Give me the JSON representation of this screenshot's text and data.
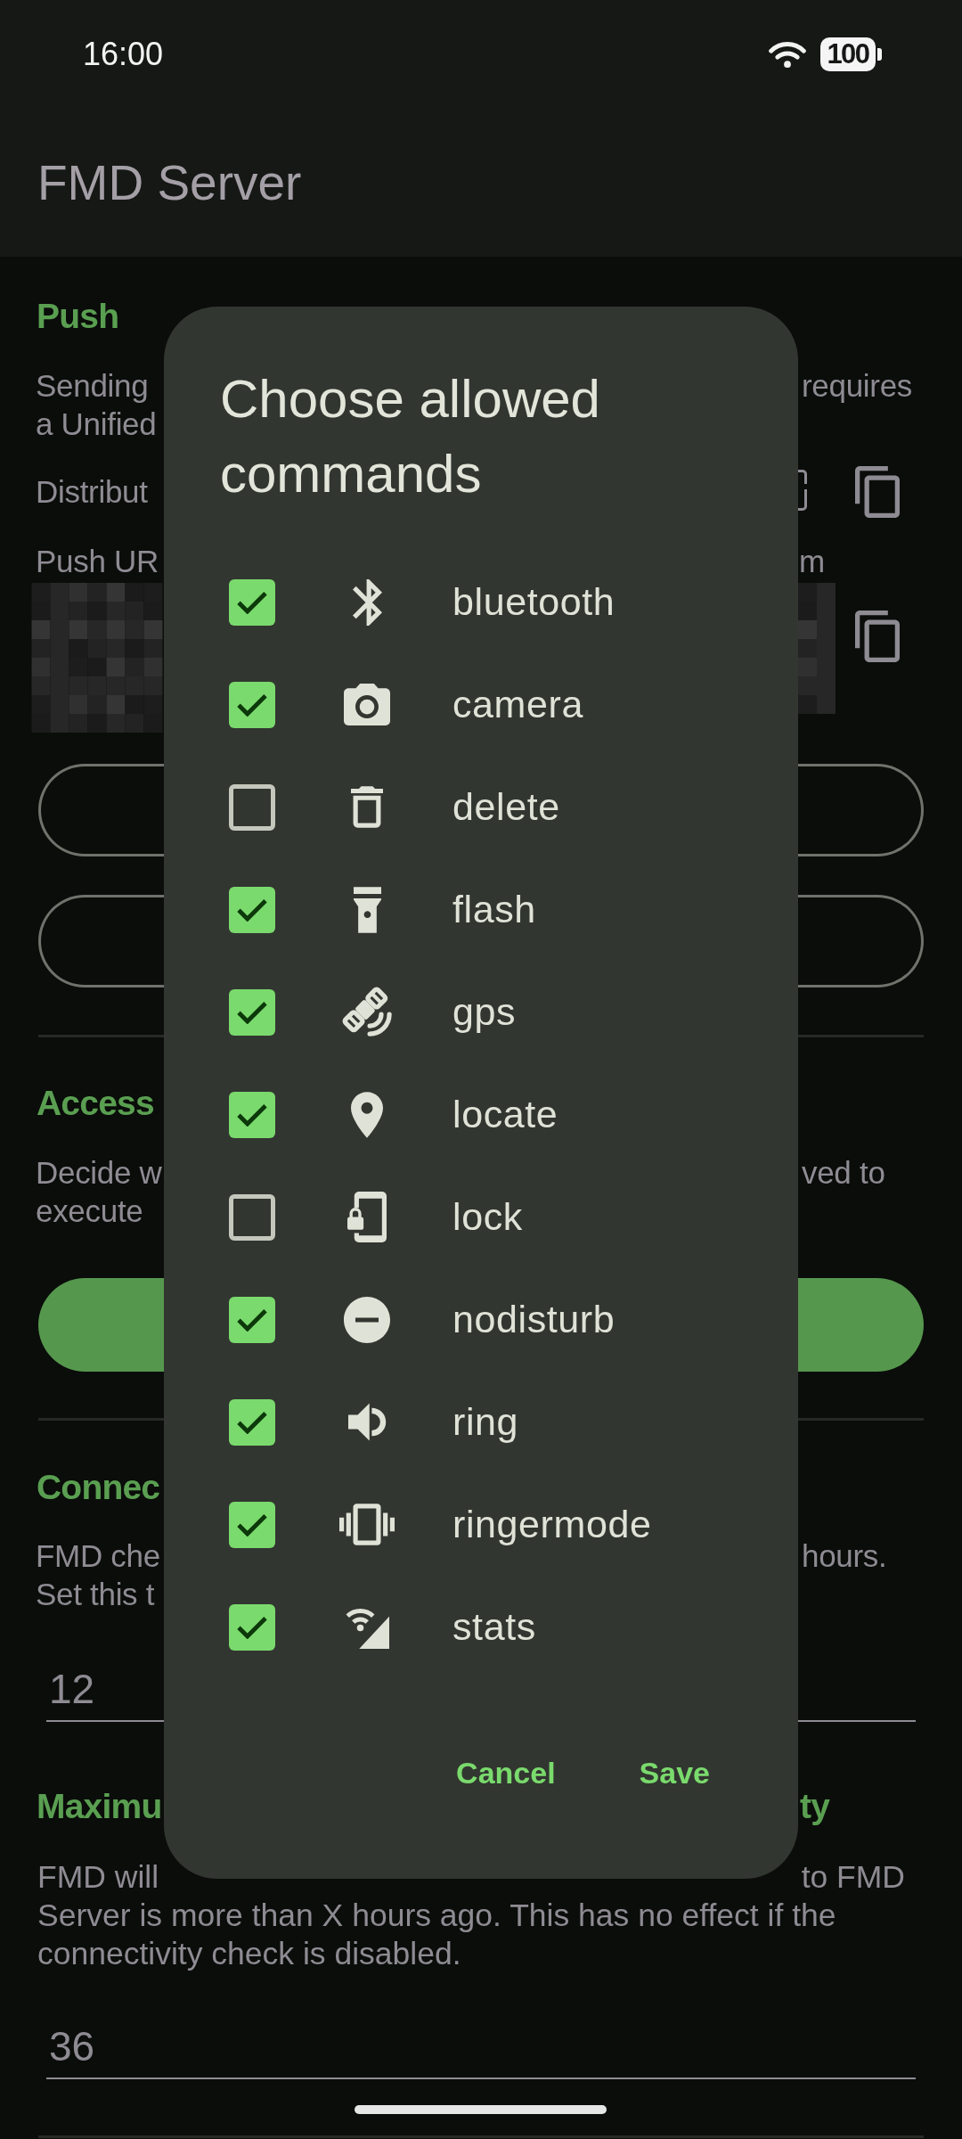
{
  "status_bar": {
    "time": "16:00",
    "battery": "100"
  },
  "app_bar": {
    "title": "FMD Server"
  },
  "push": {
    "heading": "Push",
    "description_lines": [
      {
        "left": "Sending",
        "right": "requires"
      },
      {
        "left": "a Unified"
      }
    ],
    "distributor_label": "Distribut",
    "push_url_label": "Push UR",
    "push_url_right": "m"
  },
  "access": {
    "heading": "Access",
    "description_lines": [
      {
        "left": "Decide w",
        "right": "ved to"
      },
      {
        "left": "execute"
      }
    ]
  },
  "connectivity": {
    "heading": "Connec",
    "description_lines": [
      {
        "left": "FMD che",
        "right": "hours."
      },
      {
        "left": "Set this t"
      }
    ],
    "value": "12"
  },
  "max_hours": {
    "heading_left": "Maximu",
    "heading_right": "ty",
    "description_first_line": {
      "left": "FMD will",
      "right": "to FMD"
    },
    "description_rest": "Server is more than X hours ago. This has no effect if the connectivity check is disabled.",
    "value": "36"
  },
  "dialog": {
    "title": "Choose allowed commands",
    "commands": [
      {
        "label": "bluetooth",
        "checked": true
      },
      {
        "label": "camera",
        "checked": true
      },
      {
        "label": "delete",
        "checked": false
      },
      {
        "label": "flash",
        "checked": true
      },
      {
        "label": "gps",
        "checked": true
      },
      {
        "label": "locate",
        "checked": true
      },
      {
        "label": "lock",
        "checked": false
      },
      {
        "label": "nodisturb",
        "checked": true
      },
      {
        "label": "ring",
        "checked": true
      },
      {
        "label": "ringermode",
        "checked": true
      },
      {
        "label": "stats",
        "checked": true
      }
    ],
    "buttons": [
      "Cancel",
      "Save"
    ]
  }
}
